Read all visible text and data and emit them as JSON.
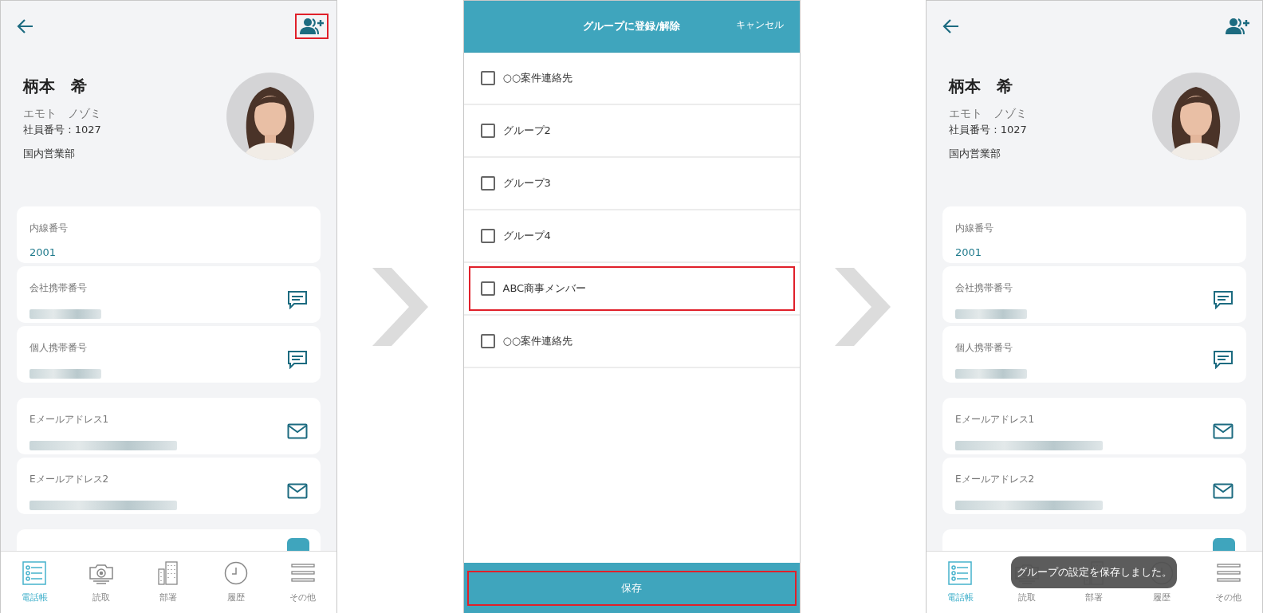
{
  "screens": [
    {
      "kind": "contact",
      "add_button": {
        "highlighted": true
      },
      "name": "柄本　希",
      "kana": "エモト　ノゾミ",
      "employee_no": "社員番号 : 1027",
      "department": "国内営業部",
      "card_groups": [
        [
          {
            "label": "内線番号",
            "value": "2001",
            "kind": "plain"
          },
          {
            "label": "会社携帯番号",
            "kind": "sms"
          },
          {
            "label": "個人携帯番号",
            "kind": "sms"
          }
        ],
        [
          {
            "label": "Eメールアドレス1",
            "kind": "mail"
          },
          {
            "label": "Eメールアドレス2",
            "kind": "mail"
          }
        ]
      ],
      "nav": [
        {
          "label": "電話帳",
          "selected": true
        },
        {
          "label": "読取",
          "selected": false
        },
        {
          "label": "部署",
          "selected": false
        },
        {
          "label": "履歴",
          "selected": false
        },
        {
          "label": "その他",
          "selected": false
        }
      ]
    },
    {
      "kind": "group_dialog",
      "title": "グループに登録/解除",
      "cancel": "キャンセル",
      "groups": [
        {
          "label": "○○案件連絡先",
          "checked": false,
          "highlighted": false
        },
        {
          "label": "グループ2",
          "checked": false,
          "highlighted": false
        },
        {
          "label": "グループ3",
          "checked": false,
          "highlighted": false
        },
        {
          "label": "グループ4",
          "checked": false,
          "highlighted": false
        },
        {
          "label": "ABC商事メンバー",
          "checked": false,
          "highlighted": true
        },
        {
          "label": "○○案件連絡先",
          "checked": false,
          "highlighted": false
        }
      ],
      "save": {
        "label": "保存",
        "highlighted": true
      }
    },
    {
      "kind": "contact",
      "add_button": {
        "highlighted": false
      },
      "name": "柄本　希",
      "kana": "エモト　ノゾミ",
      "employee_no": "社員番号 : 1027",
      "department": "国内営業部",
      "card_groups": [
        [
          {
            "label": "内線番号",
            "value": "2001",
            "kind": "plain"
          },
          {
            "label": "会社携帯番号",
            "kind": "sms"
          },
          {
            "label": "個人携帯番号",
            "kind": "sms"
          }
        ],
        [
          {
            "label": "Eメールアドレス1",
            "kind": "mail"
          },
          {
            "label": "Eメールアドレス2",
            "kind": "mail"
          }
        ]
      ],
      "nav": [
        {
          "label": "電話帳",
          "selected": true
        },
        {
          "label": "読取",
          "selected": false
        },
        {
          "label": "部署",
          "selected": false
        },
        {
          "label": "履歴",
          "selected": false
        },
        {
          "label": "その他",
          "selected": false
        }
      ],
      "toast": "グループの設定を保存しました。"
    }
  ]
}
